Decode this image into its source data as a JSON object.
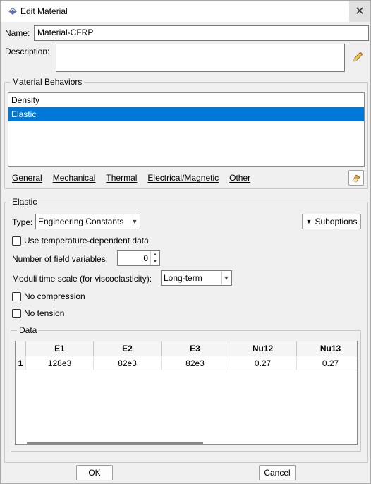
{
  "window": {
    "title": "Edit Material",
    "close_glyph": "✕"
  },
  "name": {
    "label": "Name:",
    "value": "Material-CFRP"
  },
  "description": {
    "label": "Description:",
    "value": ""
  },
  "behaviors": {
    "group_title": "Material Behaviors",
    "items": [
      {
        "label": "Density",
        "selected": false
      },
      {
        "label": "Elastic",
        "selected": true
      }
    ],
    "selected_color": "#0078d7"
  },
  "menus": [
    "General",
    "Mechanical",
    "Thermal",
    "Electrical/Magnetic",
    "Other"
  ],
  "elastic": {
    "group_title": "Elastic",
    "type_label": "Type:",
    "type_value": "Engineering Constants",
    "suboptions_label": "Suboptions",
    "temp_dependent_label": "Use temperature-dependent data",
    "field_vars_label": "Number of field variables:",
    "field_vars_value": "0",
    "moduli_label": "Moduli time scale (for viscoelasticity):",
    "moduli_value": "Long-term",
    "no_compression_label": "No compression",
    "no_tension_label": "No tension"
  },
  "data_table": {
    "group_title": "Data",
    "columns": [
      "",
      "E1",
      "E2",
      "E3",
      "Nu12",
      "Nu13"
    ],
    "rows": [
      [
        "1",
        "128e3",
        "82e3",
        "82e3",
        "0.27",
        "0.27"
      ]
    ]
  },
  "buttons": {
    "ok": "OK",
    "cancel": "Cancel"
  },
  "icons": {
    "app": "material-app-icon",
    "edit_description": "pencil-icon",
    "behavior_edit": "eraser-icon"
  }
}
